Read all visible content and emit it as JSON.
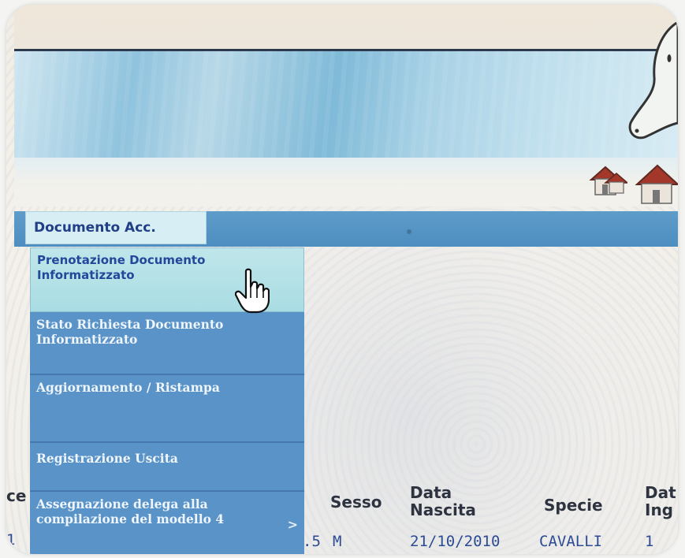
{
  "menu": {
    "active_tab": "Documento Acc.",
    "items": [
      {
        "label": "Prenotazione Documento Informatizzato"
      },
      {
        "label": "Stato Richiesta Documento Informatizzato"
      },
      {
        "label": "Aggiornamento / Ristampa"
      },
      {
        "label": "Registrazione Uscita"
      },
      {
        "label": "Assegnazione delega alla compilazione del modello 4",
        "arrow": ">"
      }
    ]
  },
  "table": {
    "headers": {
      "partial_left": "ce",
      "sesso": "Sesso",
      "data_nascita": "Data Nascita",
      "specie": "Specie",
      "data_ingresso": "Dat Ing"
    },
    "row": {
      "partial_left": "1",
      "partial_before_sex": ".5",
      "sesso": "M",
      "data_nascita": "21/10/2010",
      "specie": "CAVALLI",
      "data_ingresso": "1"
    }
  },
  "colors": {
    "menubar": "#4d8ec0",
    "dropdown": "#5a93c8",
    "hover_item": "#a9dde3",
    "tab_text": "#203f86"
  },
  "icons": [
    "home-icon",
    "home-icon",
    "hand-pointer-cursor-icon",
    "horse-logo",
    "submenu-arrow-icon"
  ]
}
